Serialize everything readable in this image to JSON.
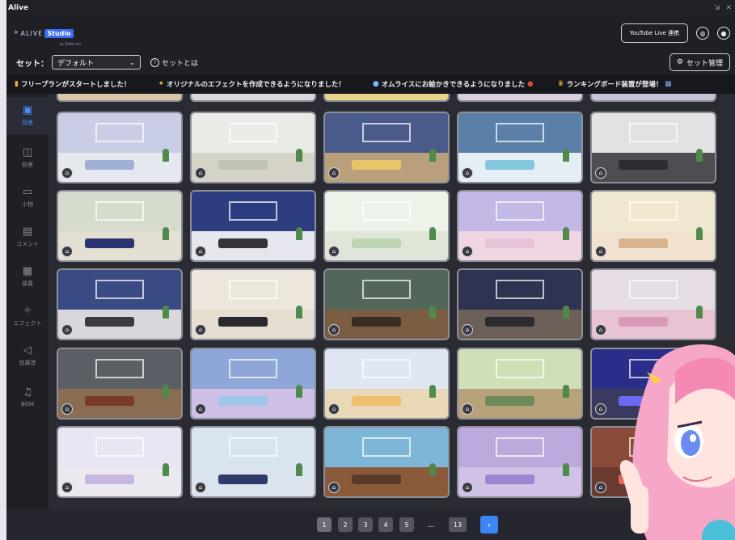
{
  "app": {
    "title": "Alive",
    "window_controls": "⇲ ✕"
  },
  "header": {
    "brand": "ALIVE",
    "studio": "Studio",
    "sub": "by DMM.com",
    "youtube_button": "YouTube Live 連携",
    "icons": [
      "globe-icon",
      "user-icon"
    ]
  },
  "setbar": {
    "label": "セット：",
    "selected": "デフォルト",
    "help_text": "セットとは",
    "manage_button": "セット管理"
  },
  "ticker": [
    {
      "icon": "▮",
      "text": "フリープランがスタートしました！"
    },
    {
      "icon": "✦",
      "text": "オリジナルのエフェクトを作成できるようになりました！"
    },
    {
      "icon": "●",
      "text": "オムライスにお絵かきできるようになりました"
    },
    {
      "icon": "♛",
      "text": "ランキングボード装置が登場！"
    }
  ],
  "sidebar": [
    {
      "label": "背景",
      "icon": "▣",
      "active": true
    },
    {
      "label": "前景",
      "icon": "◫",
      "active": false
    },
    {
      "label": "小物",
      "icon": "▭",
      "active": false
    },
    {
      "label": "コメント",
      "icon": "▤",
      "active": false
    },
    {
      "label": "装置",
      "icon": "▦",
      "active": false
    },
    {
      "label": "エフェクト",
      "icon": "✧",
      "active": false
    },
    {
      "label": "効果音",
      "icon": "◁",
      "active": false
    },
    {
      "label": "BGM",
      "icon": "♫",
      "active": false
    }
  ],
  "backgrounds": [
    {
      "wall": "#c9cde6",
      "floor": "#e6e8f0",
      "sofa": "#9fb2d6"
    },
    {
      "wall": "#e8ebe6",
      "floor": "#d5d2c8",
      "sofa": "#bfc3b8"
    },
    {
      "wall": "#4a5a8a",
      "floor": "#b9a07a",
      "sofa": "#e8c56a"
    },
    {
      "wall": "#5a7fa8",
      "floor": "#e4eef4",
      "sofa": "#86c7e0"
    },
    {
      "wall": "#e2e2e2",
      "floor": "#4d4d52",
      "sofa": "#2c2c31"
    },
    {
      "wall": "#d6dccd",
      "floor": "#e3dfd2",
      "sofa": "#2b3470"
    },
    {
      "wall": "#2e3c80",
      "floor": "#e6e6ee",
      "sofa": "#323238"
    },
    {
      "wall": "#eef3ea",
      "floor": "#dfe6d8",
      "sofa": "#bcd6b4"
    },
    {
      "wall": "#c3b8e6",
      "floor": "#efd6e2",
      "sofa": "#e7c4d8"
    },
    {
      "wall": "#efe7d0",
      "floor": "#f1e2cf",
      "sofa": "#d9b38f"
    },
    {
      "wall": "#3a4a82",
      "floor": "#d8d8dc",
      "sofa": "#3b3b40"
    },
    {
      "wall": "#ede6dc",
      "floor": "#e4ddd0",
      "sofa": "#2a2a2e"
    },
    {
      "wall": "#52665a",
      "floor": "#7a5e44",
      "sofa": "#3a2c22"
    },
    {
      "wall": "#2d3350",
      "floor": "#6b5f58",
      "sofa": "#2a2a30"
    },
    {
      "wall": "#e6dce4",
      "floor": "#e8c3d3",
      "sofa": "#d99ab8"
    },
    {
      "wall": "#5c5e66",
      "floor": "#8a6c52",
      "sofa": "#7a3b2c"
    },
    {
      "wall": "#8ea6d8",
      "floor": "#cdbfe6",
      "sofa": "#9ec6e8"
    },
    {
      "wall": "#dfe8f2",
      "floor": "#e8d8b8",
      "sofa": "#f0c070"
    },
    {
      "wall": "#cfe0b8",
      "floor": "#b8a27a",
      "sofa": "#6d8a5a"
    },
    {
      "wall": "#2a2e8a",
      "floor": "#3a3a5e",
      "sofa": "#6a6af0"
    },
    {
      "wall": "#e8e6f2",
      "floor": "#ece8f0",
      "sofa": "#c8b8e0"
    },
    {
      "wall": "#d8e4f0",
      "floor": "#dbe4ee",
      "sofa": "#2f3a6a"
    },
    {
      "wall": "#7eb6d8",
      "floor": "#8a5a3a",
      "sofa": "#5a3a28"
    },
    {
      "wall": "#bcaadc",
      "floor": "#cfc2e6",
      "sofa": "#9b86d0"
    },
    {
      "wall": "#8a4a3a",
      "floor": "#6a3a2e",
      "sofa": "#e06a5a"
    }
  ],
  "pagination": {
    "pages": [
      "1",
      "2",
      "3",
      "4",
      "5"
    ],
    "ellipsis": "...",
    "last": "13",
    "next": "›",
    "current": "1"
  },
  "colors": {
    "accent": "#3d84f5",
    "active_nav": "#4c8dff"
  }
}
